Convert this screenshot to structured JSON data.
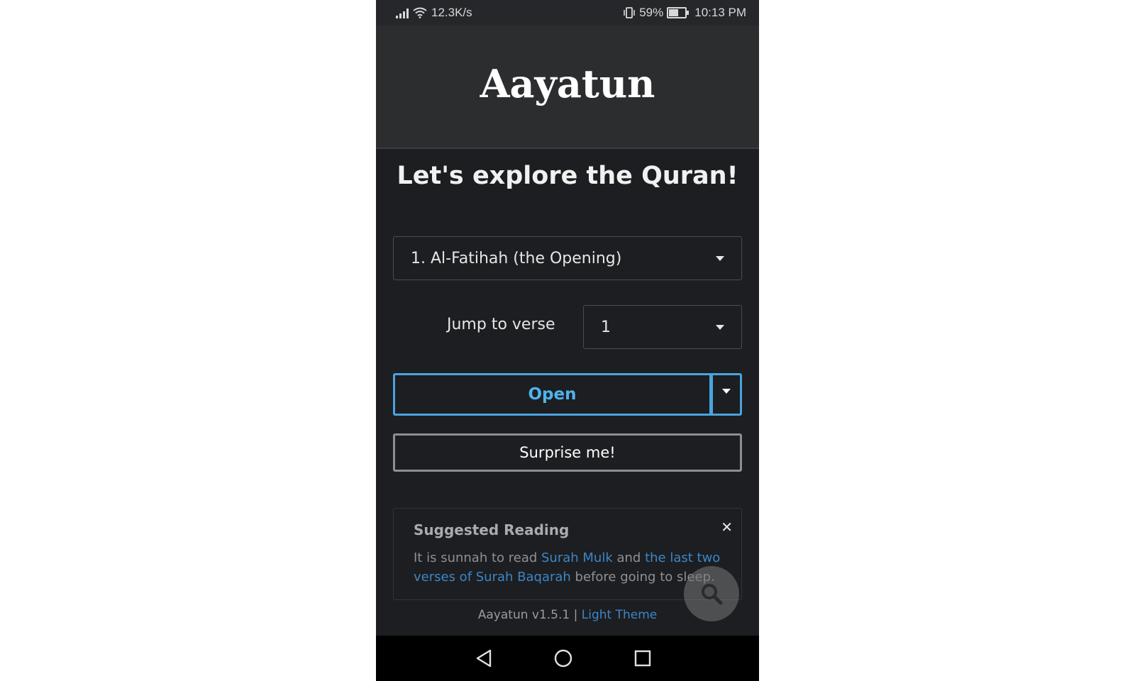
{
  "status_bar": {
    "speed": "12.3K/s",
    "battery_percent": "59%",
    "time": "10:13 PM",
    "icons": [
      "signal-icon",
      "wifi-icon",
      "vibrate-icon",
      "battery-icon"
    ]
  },
  "header": {
    "title": "Aayatun"
  },
  "main": {
    "headline": "Let's explore the Quran!",
    "surah_select": {
      "value": "1. Al-Fatihah (the Opening)"
    },
    "verse_label": "Jump to verse",
    "verse_select": {
      "value": "1"
    },
    "open_label": "Open",
    "surprise_label": "Surprise me!"
  },
  "suggested_reading": {
    "title": "Suggested Reading",
    "text_before": "It is sunnah to read ",
    "link_1": "Surah Mulk",
    "text_middle": " and ",
    "link_2": "the last two verses of Surah Baqarah",
    "text_after": " before going to sleep.",
    "close_glyph": "✕"
  },
  "footer": {
    "version": "Aayatun v1.5.1",
    "separator": " | ",
    "theme_link": "Light Theme"
  },
  "colors": {
    "background": "#1c1e21",
    "header": "#2c2d2f",
    "accent": "#4aa3df",
    "link": "#3d86c6"
  }
}
